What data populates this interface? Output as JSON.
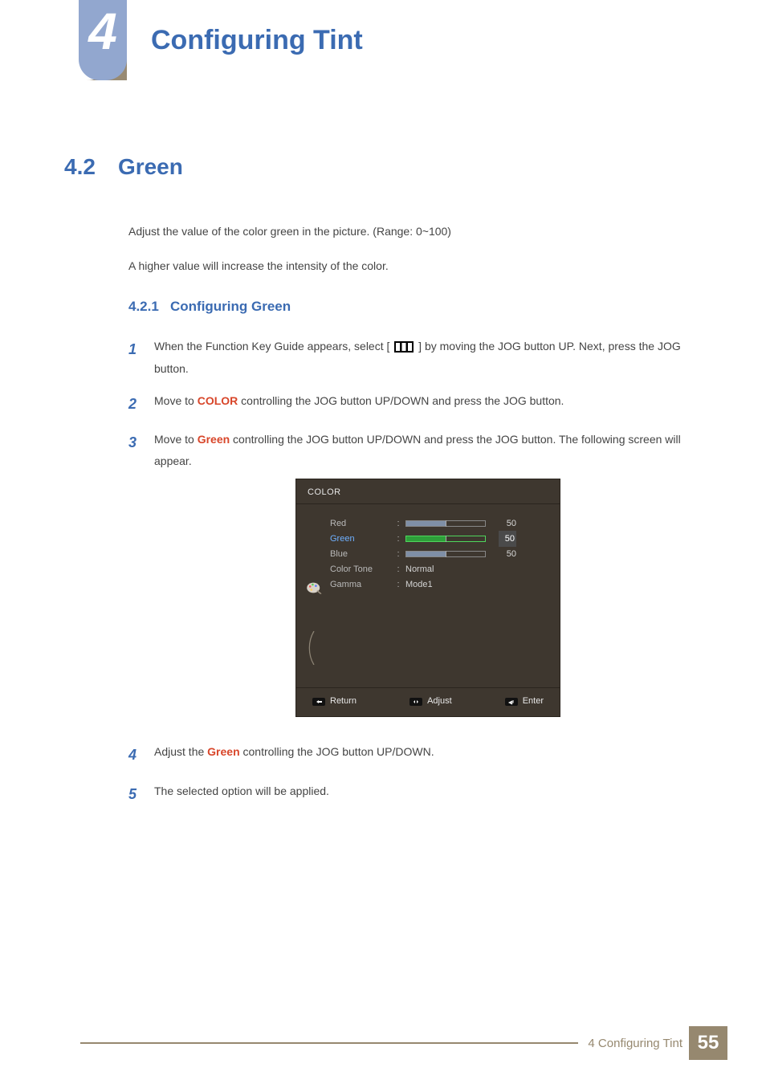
{
  "chapter": {
    "number": "4",
    "title": "Configuring Tint"
  },
  "section": {
    "number": "4.2",
    "title": "Green"
  },
  "intro": {
    "p1": "Adjust the value of the color green in the picture. (Range: 0~100)",
    "p2": "A higher value will increase the intensity of the color."
  },
  "subsection": {
    "number": "4.2.1",
    "title": "Configuring Green"
  },
  "steps": {
    "s1": {
      "num": "1",
      "t1": "When the Function Key Guide appears, select ",
      "t2": " by moving the JOG button UP. Next, press the JOG button."
    },
    "s2": {
      "num": "2",
      "t1": "Move to ",
      "hl": "COLOR",
      "t2": " controlling the JOG button UP/DOWN and press the JOG button."
    },
    "s3": {
      "num": "3",
      "t1": "Move to ",
      "hl": "Green",
      "t2": " controlling the JOG button UP/DOWN and press the JOG button. The following screen will appear."
    },
    "s4": {
      "num": "4",
      "t1": "Adjust the ",
      "hl": "Green",
      "t2": " controlling the JOG button UP/DOWN."
    },
    "s5": {
      "num": "5",
      "t1": "The selected option will be applied."
    }
  },
  "osd": {
    "title": "COLOR",
    "rows": {
      "red": {
        "label": "Red",
        "value": "50",
        "fill": 50
      },
      "green": {
        "label": "Green",
        "value": "50",
        "fill": 50
      },
      "blue": {
        "label": "Blue",
        "value": "50",
        "fill": 50
      },
      "tone": {
        "label": "Color Tone",
        "value": "Normal"
      },
      "gamma": {
        "label": "Gamma",
        "value": "Mode1"
      }
    },
    "footer": {
      "return": "Return",
      "adjust": "Adjust",
      "enter": "Enter"
    }
  },
  "footer": {
    "text": "4 Configuring Tint",
    "page": "55"
  }
}
